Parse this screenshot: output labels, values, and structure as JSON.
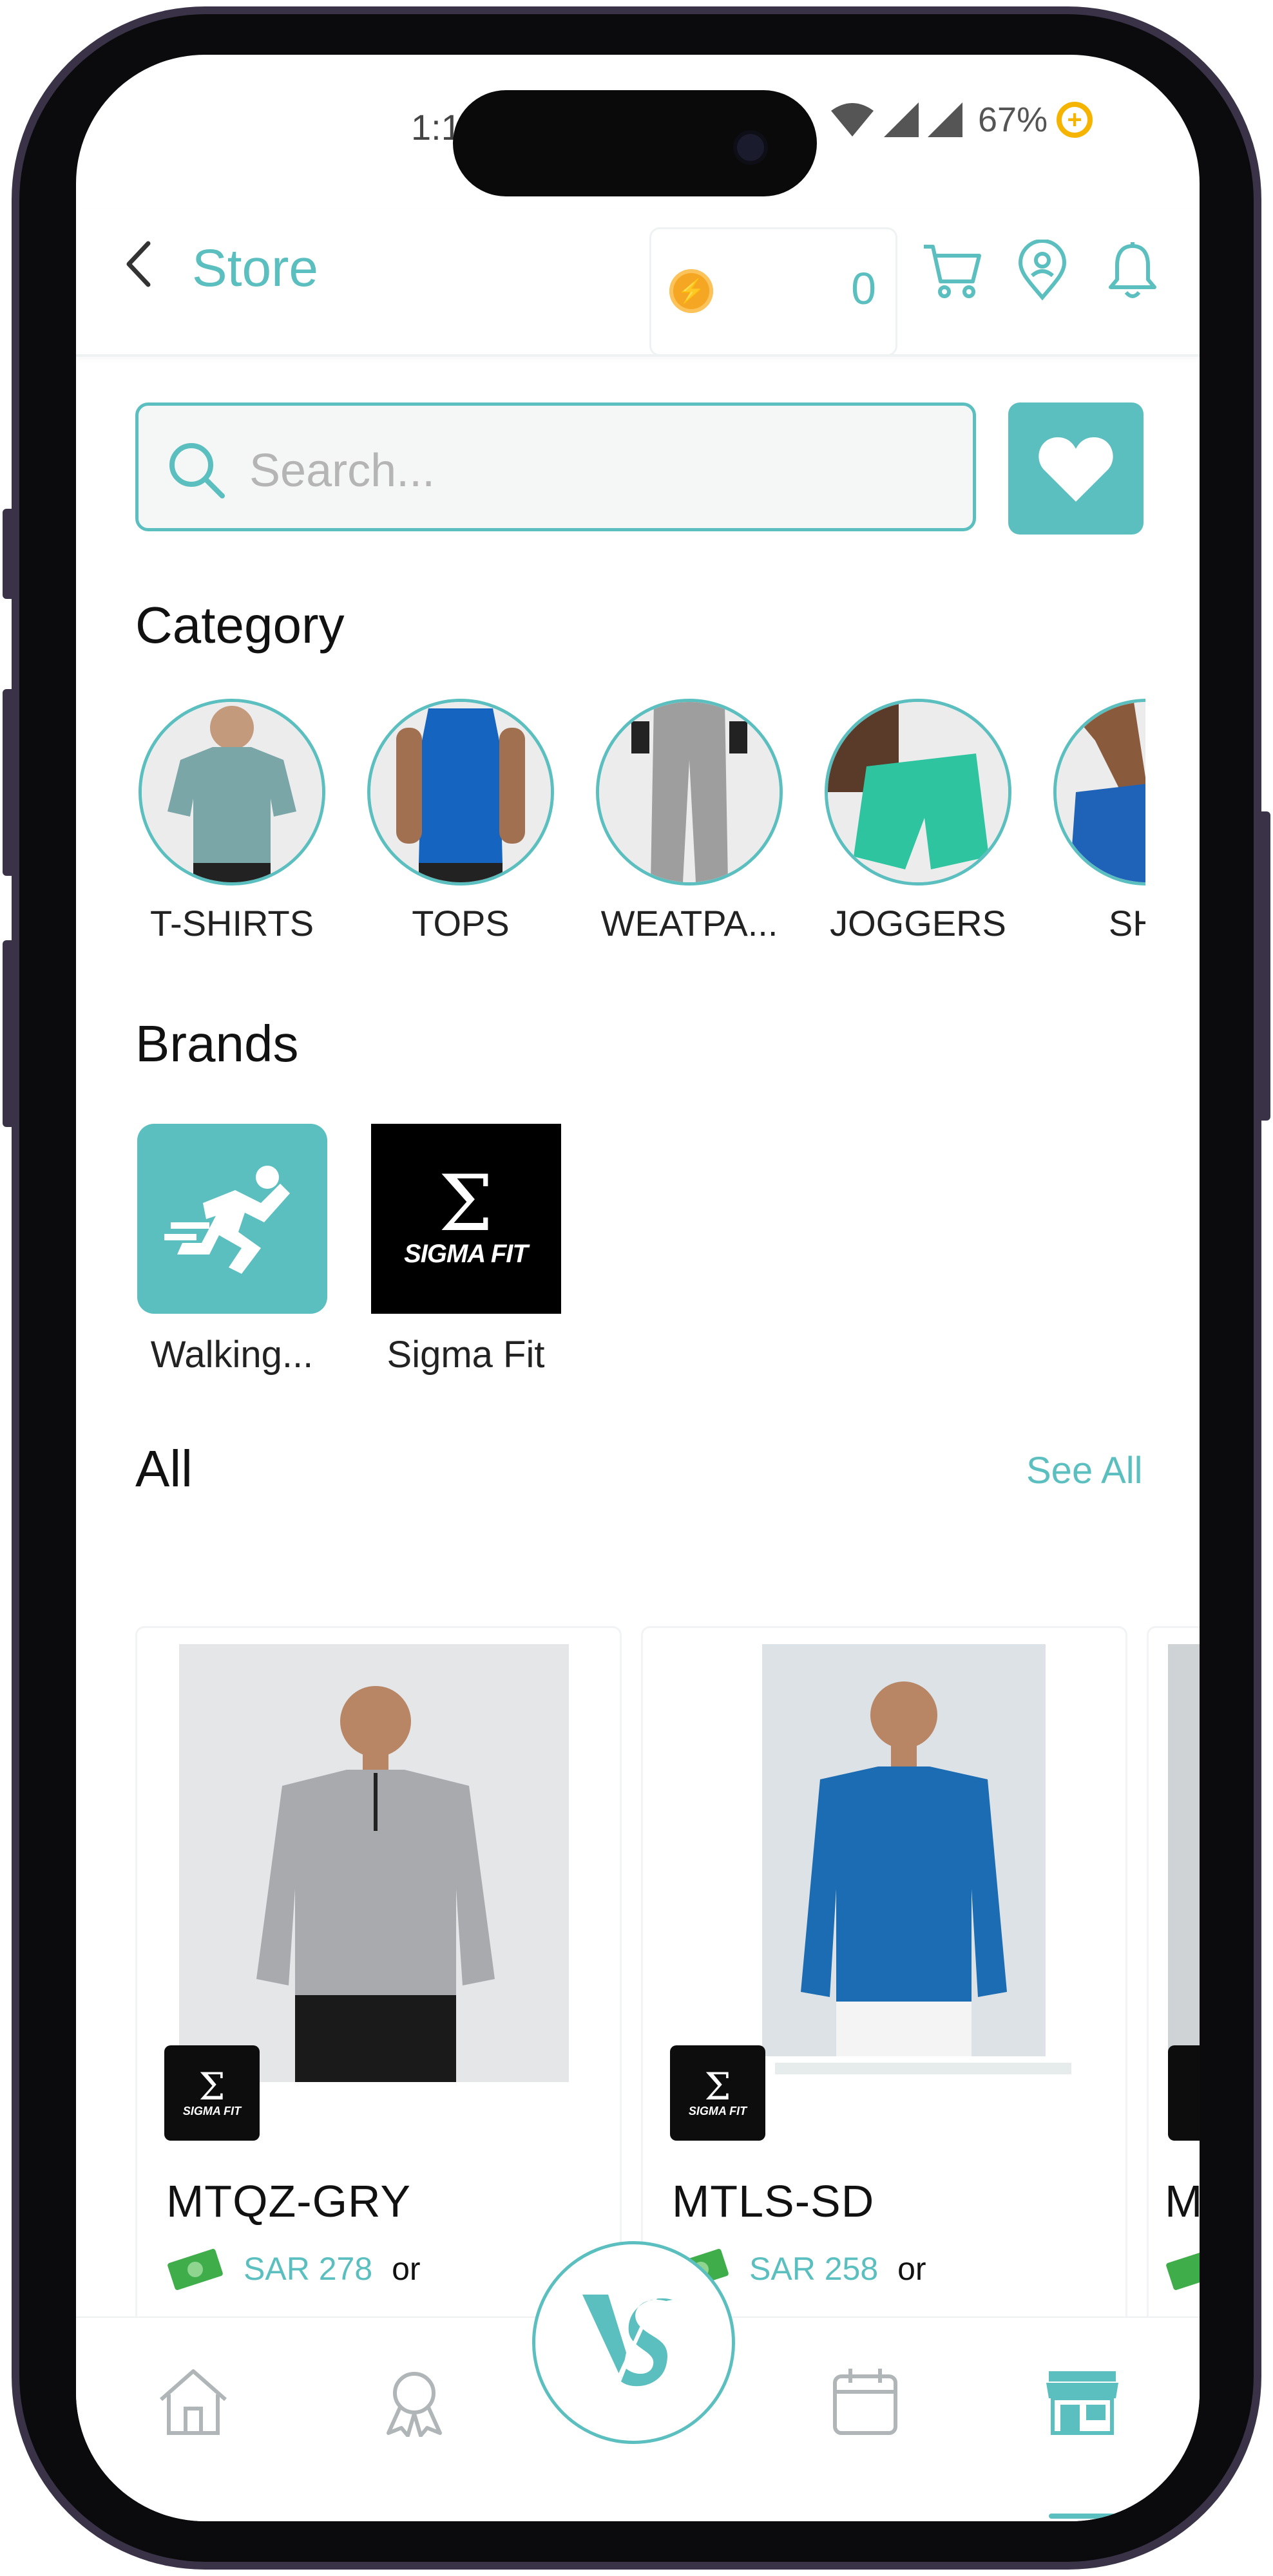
{
  "status_bar": {
    "time": "1:1",
    "battery": "67%"
  },
  "header": {
    "title": "Store",
    "coins": "0"
  },
  "search": {
    "placeholder": "Search..."
  },
  "category": {
    "title": "Category",
    "items": [
      {
        "label": "T-SHIRTS",
        "color": "#7aa6a8"
      },
      {
        "label": "TOPS",
        "color": "#1565c0"
      },
      {
        "label": "WEATPA...",
        "color": "#9e9e9e"
      },
      {
        "label": "JOGGERS",
        "color": "#2ec4a0"
      },
      {
        "label": "SHC",
        "color": "#1e63b8"
      }
    ]
  },
  "brands": {
    "title": "Brands",
    "items": [
      {
        "label": "Walking...",
        "logo_icon": "runner-logo-icon"
      },
      {
        "label": "Sigma Fit",
        "logo_text": "SIGMA FIT"
      }
    ]
  },
  "all": {
    "title": "All",
    "see_all": "See All",
    "products": [
      {
        "name": "MTQZ-GRY",
        "price": "SAR 278",
        "or": "or",
        "shirt_color": "#a9aaad"
      },
      {
        "name": "MTLS-SD",
        "price": "SAR 258",
        "or": "or",
        "shirt_color": "#1b6cb3"
      },
      {
        "name": "M",
        "price": "",
        "or": "",
        "shirt_color": "#cfd3d6"
      }
    ]
  },
  "badge_text": "SIGMA FIT",
  "colors": {
    "accent": "#5bbfbf",
    "coin": "#f5a623"
  }
}
